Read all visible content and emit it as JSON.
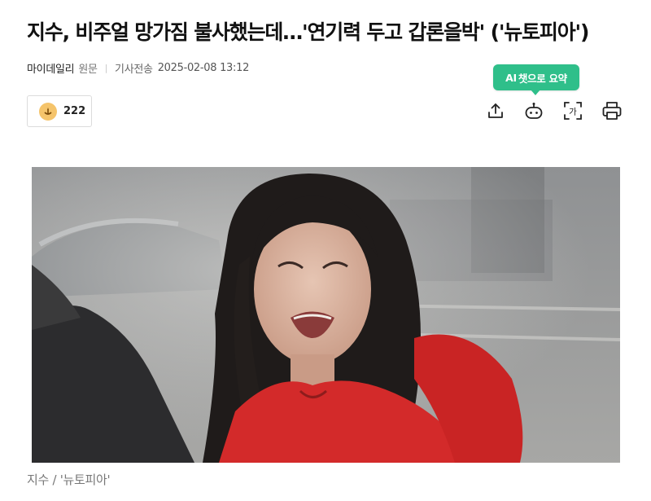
{
  "article": {
    "headline": "지수, 비주얼 망가짐 불사했는데…'연기력 두고 갑론을박' ('뉴토피아')",
    "press": "마이데일리",
    "origin": "원문",
    "sent_label": "기사전송",
    "sent_time": "2025-02-08 13:12",
    "reaction_count": "222",
    "caption": "지수 / '뉴토피아'"
  },
  "toolbar": {
    "ai_prefix": "AI",
    "ai_label": "챗으로 요약",
    "font_icon_text": "가"
  },
  "colors": {
    "accent": "#2fbf8a",
    "reaction_icon": "#f5c46b"
  },
  "icons": [
    "share-icon",
    "ai-chat-icon",
    "font-size-icon",
    "print-icon",
    "reaction-icon"
  ]
}
